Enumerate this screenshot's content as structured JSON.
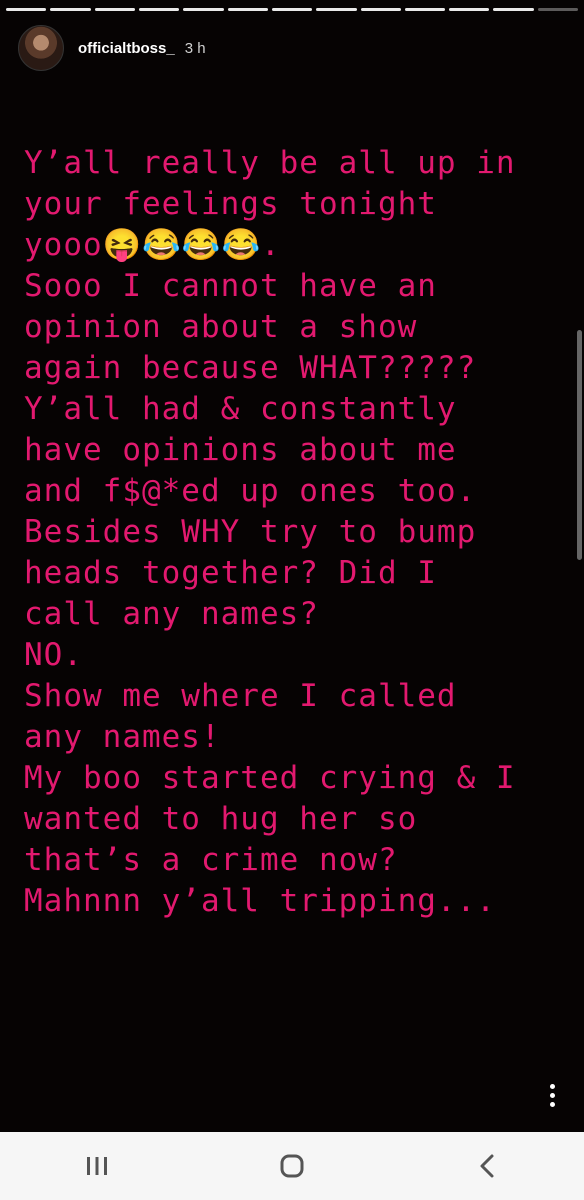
{
  "story": {
    "username": "officialtboss_",
    "time_ago": "3 h",
    "progress_total": 13,
    "progress_done": 12,
    "caption_lines": [
      "Y’all really be all up in",
      "your feelings tonight",
      "yooo😝😂😂😂.",
      "Sooo I cannot have an",
      "opinion about a show",
      "again because WHAT?????",
      "Y’all had & constantly",
      "have opinions about me",
      "and f$@*ed up ones too.",
      "Besides WHY try to bump",
      "heads together? Did I",
      "call any names?",
      "NO.",
      "Show me where I called",
      "any names!",
      "My boo started crying & I",
      "wanted to hug her so",
      "that’s a crime now?",
      "Mahnnn y’all tripping..."
    ]
  },
  "icons": {
    "more": "more-vertical-icon",
    "recents": "recents-icon",
    "home": "home-icon",
    "back": "back-icon"
  },
  "colors": {
    "caption": "#e2196f",
    "background": "#060303",
    "navbar": "#f6f6f6"
  }
}
